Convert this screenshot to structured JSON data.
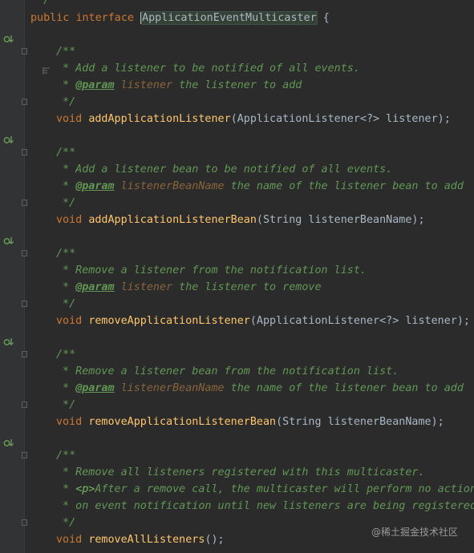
{
  "code": {
    "prev_line_tail": " */",
    "interface_line": {
      "public": "public",
      "interface": "interface",
      "name": "ApplicationEventMulticaster",
      "brace": " {"
    },
    "methods": [
      {
        "doc_open": "/**",
        "doc_desc": " * Add a listener to be notified of all events.",
        "param_tag": "@param",
        "param_name": "listener",
        "param_desc": " the listener to add",
        "doc_close": " */",
        "return_type": "void",
        "method_name": "addApplicationListener",
        "signature": "(ApplicationListener<?> listener);"
      },
      {
        "doc_open": "/**",
        "doc_desc": " * Add a listener bean to be notified of all events.",
        "param_tag": "@param",
        "param_name": "listenerBeanName",
        "param_desc": " the name of the listener bean to add",
        "doc_close": " */",
        "return_type": "void",
        "method_name": "addApplicationListenerBean",
        "signature": "(String listenerBeanName);"
      },
      {
        "doc_open": "/**",
        "doc_desc": " * Remove a listener from the notification list.",
        "param_tag": "@param",
        "param_name": "listener",
        "param_desc": " the listener to remove",
        "doc_close": " */",
        "return_type": "void",
        "method_name": "removeApplicationListener",
        "signature": "(ApplicationListener<?> listener);"
      },
      {
        "doc_open": "/**",
        "doc_desc": " * Remove a listener bean from the notification list.",
        "param_tag": "@param",
        "param_name": "listenerBeanName",
        "param_desc": " the name of the listener bean to add",
        "doc_close": " */",
        "return_type": "void",
        "method_name": "removeApplicationListenerBean",
        "signature": "(String listenerBeanName);"
      }
    ],
    "last_method": {
      "doc_open": "/**",
      "doc_line1": " * Remove all listeners registered with this multicaster.",
      "doc_line2_prefix": " * ",
      "doc_line2_tag": "<p>",
      "doc_line2_text": "After a remove call, the multicaster will perform no action",
      "doc_line3": " * on event notification until new listeners are being registered",
      "doc_close": " */",
      "return_type": "void",
      "method_name": "removeAllListeners",
      "signature": "();"
    }
  },
  "watermark": "@稀土掘金技术社区",
  "icons": {
    "implementations": "implemented-icon",
    "bookmark": "bookmark-icon",
    "fold": "fold-marker"
  },
  "colors": {
    "background": "#2b2b2b",
    "gutter": "#313335",
    "keyword": "#cc7832",
    "method": "#ffc66d",
    "doc": "#629755",
    "param": "#8a653b",
    "text": "#a9b7c6",
    "gutter_icon": "#6a9955"
  }
}
